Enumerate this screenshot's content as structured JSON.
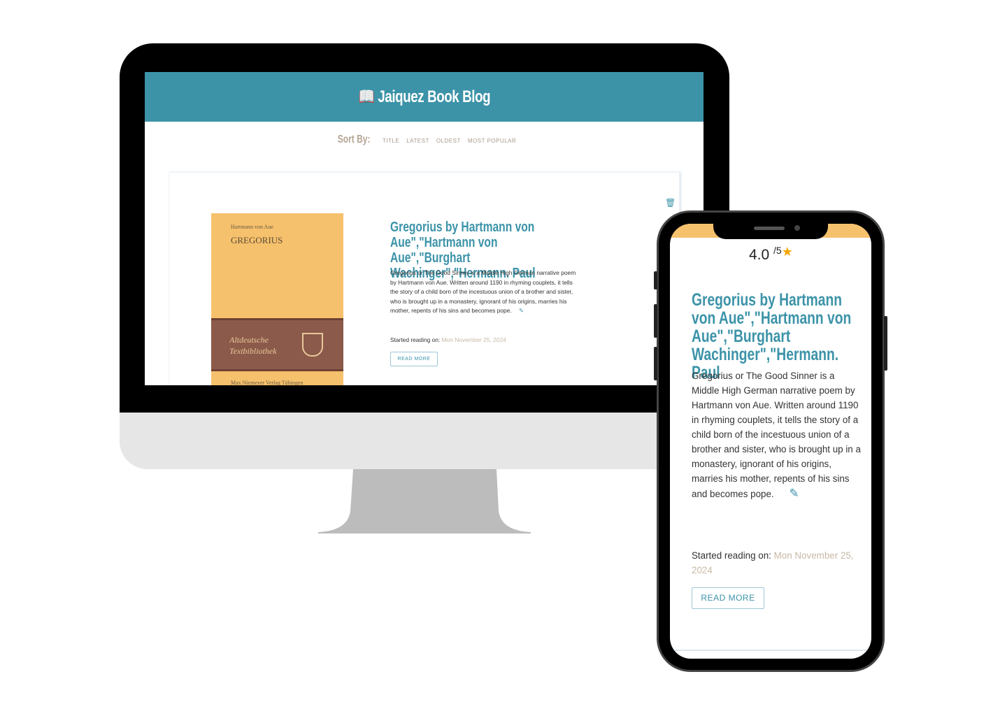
{
  "header": {
    "icon": "open-book-icon",
    "title": "Jaiquez Book Blog"
  },
  "sort": {
    "label": "Sort By:",
    "options": [
      "TITLE",
      "LATEST",
      "OLDEST",
      "MOST POPULAR"
    ]
  },
  "book": {
    "title": "Gregorius by Hartmann von Aue\",\"Hartmann von Aue\",\"Burghart Wachinger\",\"Hermann. Paul",
    "description": "Gregorius or The Good Sinner is a Middle High German narrative poem by Hartmann von Aue. Written around 1190 in rhyming couplets, it tells the story of a child born of the incestuous union of a brother and sister, who is brought up in a monastery, ignorant of his origins, marries his mother, repents of his sins and becomes pope.",
    "started_label": "Started reading on:",
    "started_date": "Mon November 25, 2024",
    "read_more": "READ MORE",
    "rating": "4.0",
    "rating_max": "/5",
    "cover": {
      "author": "Hartmann von Aue",
      "title": "GREGORIUS",
      "series": "Altdeutsche Textbibliothek",
      "publisher": "Max Niemeyer Verlag Tübingen"
    }
  },
  "colors": {
    "accent": "#3c93a8",
    "muted": "#b8a898",
    "star": "#f5a500"
  }
}
